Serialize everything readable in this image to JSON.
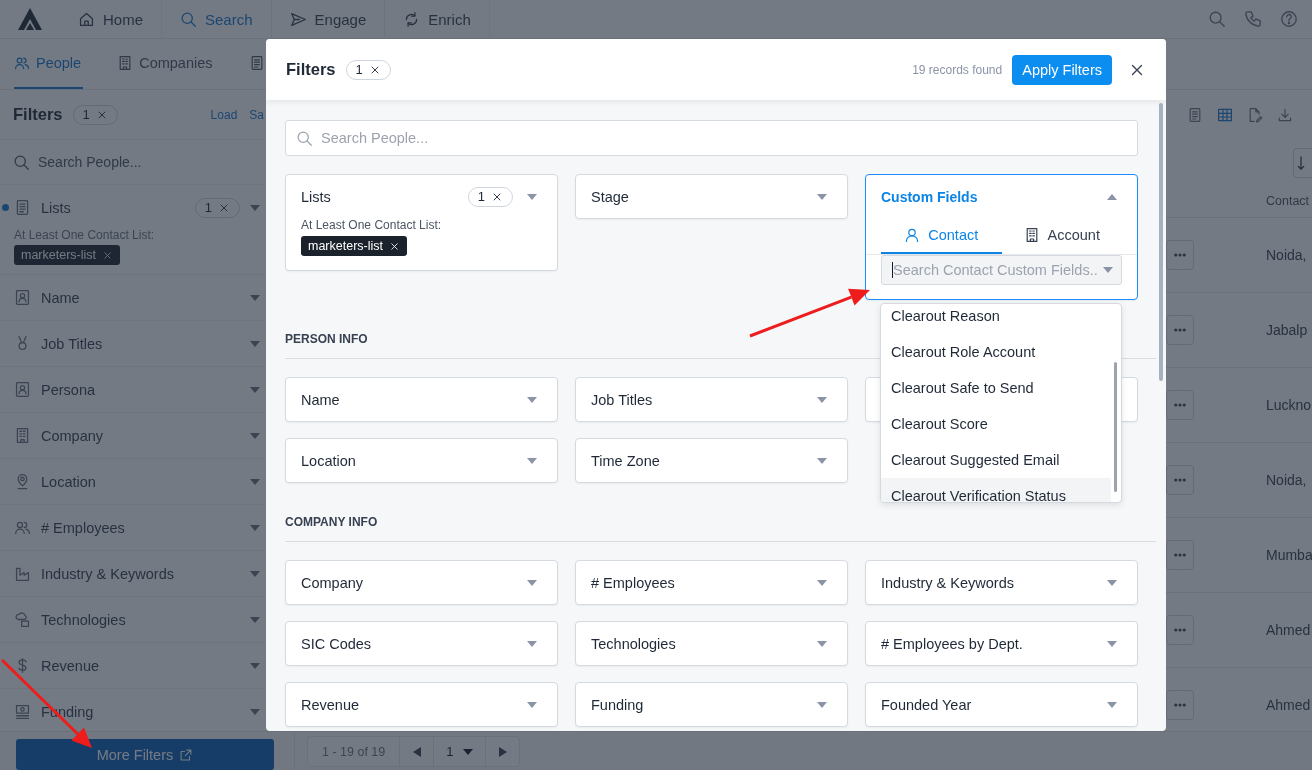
{
  "nav": {
    "items": [
      {
        "label": "Home",
        "selected": false
      },
      {
        "label": "Search",
        "selected": true
      },
      {
        "label": "Engage",
        "selected": false
      },
      {
        "label": "Enrich",
        "selected": false
      }
    ]
  },
  "page_tabs": [
    {
      "label": "People",
      "selected": true
    },
    {
      "label": "Companies",
      "selected": false
    },
    {
      "selected": false
    }
  ],
  "sidebar": {
    "title": "Filters",
    "count": "1",
    "actions": [
      "Load",
      "Sa"
    ],
    "search_placeholder": "Search People...",
    "items": [
      {
        "label": "Lists",
        "active": true,
        "count": "1",
        "condition": "At Least One Contact List:",
        "tags": [
          "marketers-list"
        ]
      },
      {
        "label": "Name",
        "active": false
      },
      {
        "label": "Job Titles",
        "active": false
      },
      {
        "label": "Persona",
        "active": false
      },
      {
        "label": "Company",
        "active": false
      },
      {
        "label": "Location",
        "active": false
      },
      {
        "label": "# Employees",
        "active": false
      },
      {
        "label": "Industry & Keywords",
        "active": false
      },
      {
        "label": "Technologies",
        "active": false
      },
      {
        "label": "Revenue",
        "active": false
      },
      {
        "label": "Funding",
        "active": false
      }
    ]
  },
  "results": {
    "column_header": "Contact",
    "rows": [
      "Noida,",
      "Jabalp",
      "Luckno",
      "Noida,",
      "Mumba",
      "Ahmed",
      "Ahmed"
    ]
  },
  "footer": {
    "more_filters": "More Filters",
    "range": "1 - 19 of 19",
    "page": "1"
  },
  "modal": {
    "title": "Filters",
    "count": "1",
    "records": "19 records found",
    "apply": "Apply Filters",
    "search_placeholder": "Search People...",
    "top_filters": [
      {
        "kind": "list",
        "label": "Lists",
        "count": "1",
        "condition": "At Least One Contact List:",
        "tags": [
          "marketers-list"
        ]
      },
      {
        "kind": "plain",
        "label": "Stage"
      },
      {
        "kind": "custom",
        "label": "Custom Fields",
        "expanded": true,
        "tabs": [
          {
            "label": "Contact",
            "selected": true
          },
          {
            "label": "Account",
            "selected": false
          }
        ],
        "search_placeholder": "Search Contact Custom Fields..",
        "options": [
          {
            "label": "Clearout Reason",
            "hovered": false
          },
          {
            "label": "Clearout Role Account",
            "hovered": false
          },
          {
            "label": "Clearout Safe to Send",
            "hovered": false
          },
          {
            "label": "Clearout Score",
            "hovered": false
          },
          {
            "label": "Clearout Suggested Email",
            "hovered": false
          },
          {
            "label": "Clearout Verification Status",
            "hovered": true
          }
        ]
      }
    ],
    "sections": [
      {
        "title": "PERSON INFO",
        "filters": [
          {
            "kind": "plain",
            "label": "Name"
          },
          {
            "kind": "plain",
            "label": "Job Titles"
          },
          {
            "kind": "covered"
          },
          {
            "kind": "plain",
            "label": "Location"
          },
          {
            "kind": "plain",
            "label": "Time Zone"
          }
        ]
      },
      {
        "title": "COMPANY INFO",
        "filters": [
          {
            "kind": "plain",
            "label": "Company"
          },
          {
            "kind": "plain",
            "label": "# Employees"
          },
          {
            "kind": "plain",
            "label": "Industry & Keywords"
          },
          {
            "kind": "plain",
            "label": "SIC Codes"
          },
          {
            "kind": "plain",
            "label": "Technologies"
          },
          {
            "kind": "plain",
            "label": "# Employees by Dept."
          },
          {
            "kind": "plain",
            "label": "Revenue"
          },
          {
            "kind": "plain",
            "label": "Funding"
          },
          {
            "kind": "plain",
            "label": "Founded Year"
          }
        ]
      }
    ]
  }
}
